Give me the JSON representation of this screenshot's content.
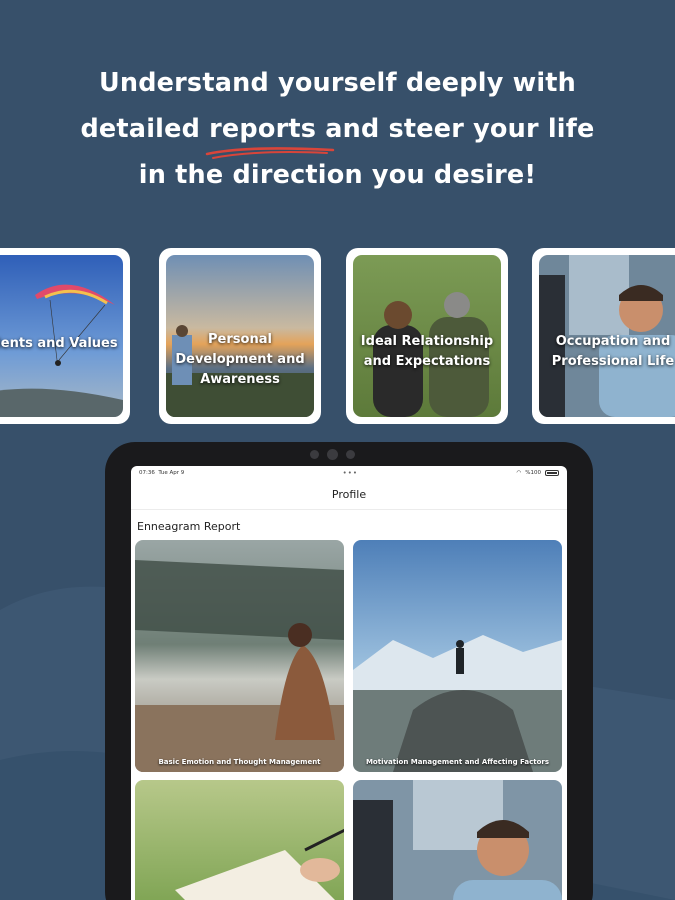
{
  "headline": {
    "line1": "Understand yourself deeply with",
    "line2_pre": "detailed ",
    "line2_highlight": "reports",
    "line2_post": " and steer your life",
    "line3": "in the direction you desire!",
    "underline_color": "#d9453a"
  },
  "categories": [
    {
      "label": "Talents and Values",
      "icon": "paraglider-photo"
    },
    {
      "label": "Personal Development and Awareness",
      "icon": "sunset-photo"
    },
    {
      "label": "Ideal Relationship and Expectations",
      "icon": "couple-photo"
    },
    {
      "label": "Occupation and Professional Life",
      "icon": "office-photo"
    }
  ],
  "tablet": {
    "status_time": "07:36",
    "status_date": "Tue Apr 9",
    "status_battery": "%100",
    "nav_title": "Profile",
    "section_title": "Enneagram Report",
    "reports": [
      {
        "label": "Basic Emotion and Thought Management",
        "icon": "lake-meditation-photo"
      },
      {
        "label": "Motivation Management and Affecting Factors",
        "icon": "mountain-summit-photo"
      },
      {
        "label": "",
        "icon": "journal-writing-photo"
      },
      {
        "label": "",
        "icon": "office-meeting-photo"
      }
    ]
  },
  "colors": {
    "background": "#37506a",
    "card_bg": "#ffffff",
    "tablet_frame": "#1a1a1c"
  }
}
